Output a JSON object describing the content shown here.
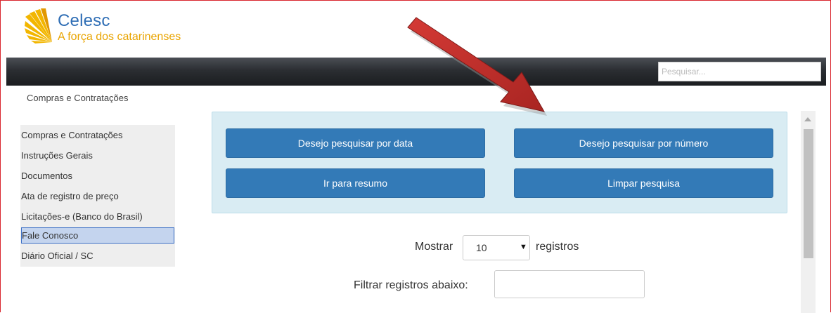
{
  "brand": {
    "name": "Celesc",
    "tagline": "A força dos catarinenses",
    "colors": {
      "name": "#2f6eb5",
      "tagline": "#e9a400"
    }
  },
  "search": {
    "placeholder": "Pesquisar..."
  },
  "breadcrumb": "Compras e Contratações",
  "sidebar": {
    "items": [
      {
        "label": "Compras e Contratações",
        "active": false
      },
      {
        "label": "Instruções Gerais",
        "active": false
      },
      {
        "label": "Documentos",
        "active": false
      },
      {
        "label": "Ata de registro de preço",
        "active": false
      },
      {
        "label": "Licitações-e (Banco do Brasil)",
        "active": false
      },
      {
        "label": "Fale Conosco",
        "active": true
      },
      {
        "label": "Diário Oficial / SC",
        "active": false
      }
    ]
  },
  "panel": {
    "buttons": {
      "by_date": "Desejo pesquisar por data",
      "by_number": "Desejo pesquisar por número",
      "summary": "Ir para resumo",
      "clear": "Limpar pesquisa"
    },
    "button_color": "#337ab7"
  },
  "controls": {
    "show_label": "Mostrar",
    "show_value": "10",
    "show_suffix": "registros",
    "filter_label": "Filtrar registros abaixo:",
    "filter_value": ""
  },
  "icons": {
    "logo": "sun-rays-icon",
    "select_caret": "caret-down-icon",
    "annotation": "annotation-arrow-icon"
  }
}
